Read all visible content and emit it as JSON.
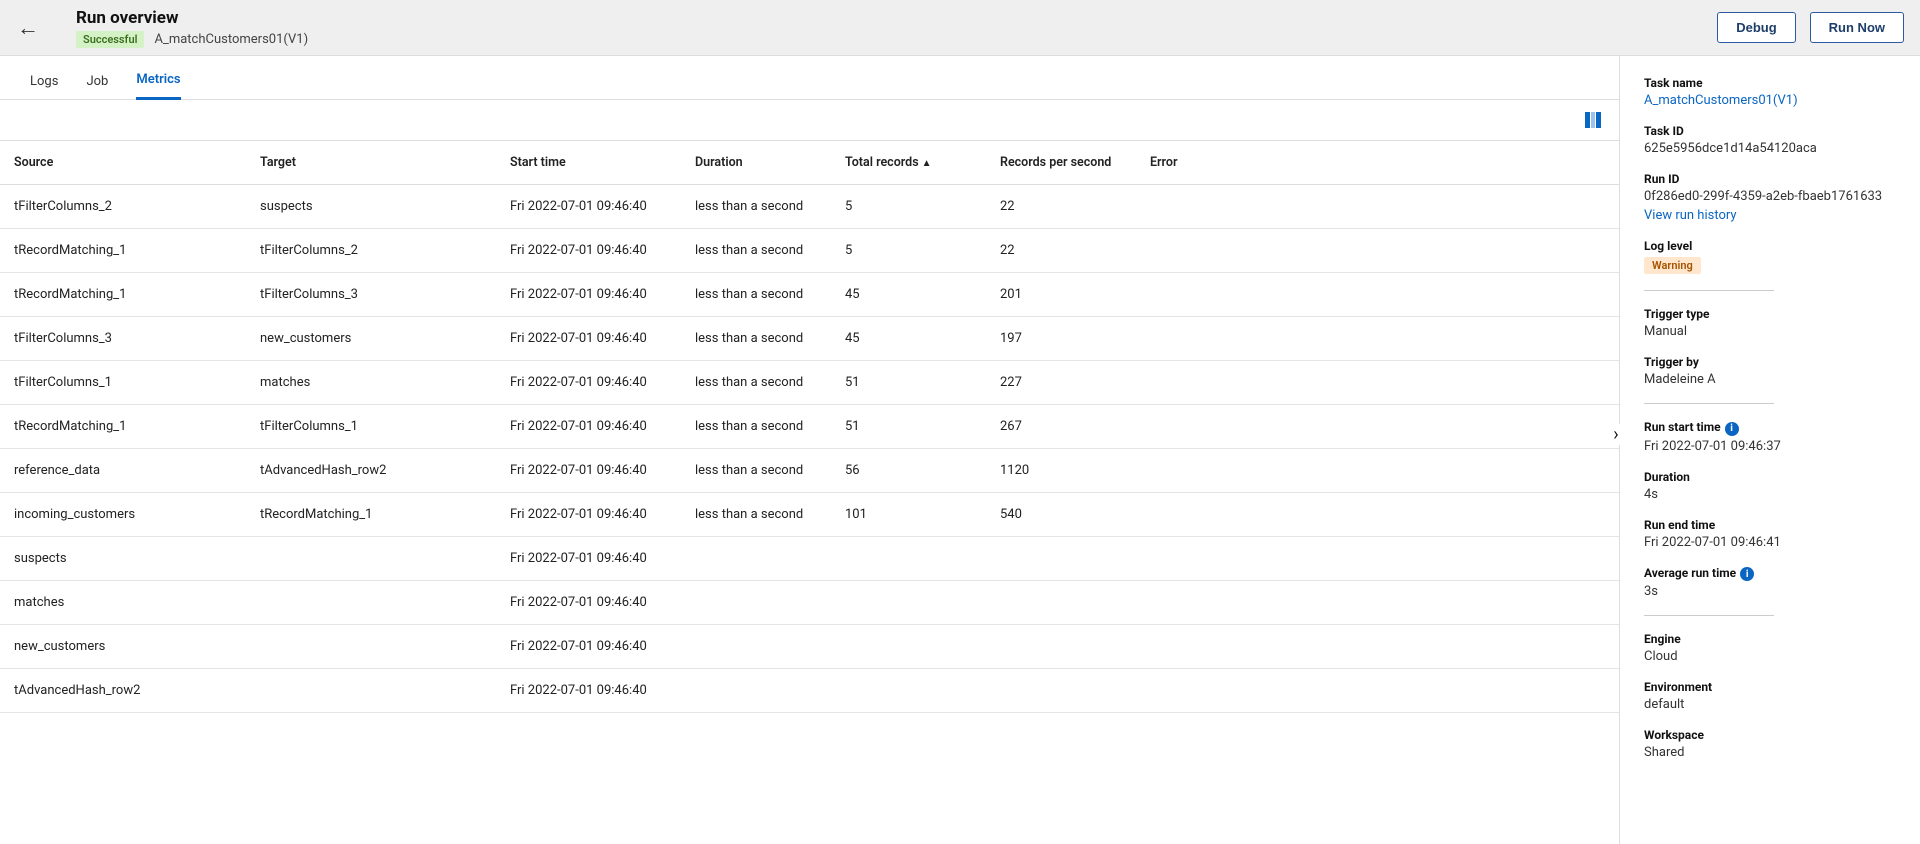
{
  "header": {
    "title": "Run overview",
    "status": "Successful",
    "task_name": "A_matchCustomers01(V1)",
    "debug_label": "Debug",
    "run_now_label": "Run Now"
  },
  "tabs": [
    {
      "label": "Logs",
      "active": false
    },
    {
      "label": "Job",
      "active": false
    },
    {
      "label": "Metrics",
      "active": true
    }
  ],
  "columns": [
    "Source",
    "Target",
    "Start time",
    "Duration",
    "Total records",
    "Records per second",
    "Error"
  ],
  "sort_column_index": 4,
  "rows": [
    {
      "source": "tFilterColumns_2",
      "target": "suspects",
      "start": "Fri 2022-07-01 09:46:40",
      "duration": "less than a second",
      "total": "5",
      "rps": "22",
      "error": ""
    },
    {
      "source": "tRecordMatching_1",
      "target": "tFilterColumns_2",
      "start": "Fri 2022-07-01 09:46:40",
      "duration": "less than a second",
      "total": "5",
      "rps": "22",
      "error": ""
    },
    {
      "source": "tRecordMatching_1",
      "target": "tFilterColumns_3",
      "start": "Fri 2022-07-01 09:46:40",
      "duration": "less than a second",
      "total": "45",
      "rps": "201",
      "error": ""
    },
    {
      "source": "tFilterColumns_3",
      "target": "new_customers",
      "start": "Fri 2022-07-01 09:46:40",
      "duration": "less than a second",
      "total": "45",
      "rps": "197",
      "error": ""
    },
    {
      "source": "tFilterColumns_1",
      "target": "matches",
      "start": "Fri 2022-07-01 09:46:40",
      "duration": "less than a second",
      "total": "51",
      "rps": "227",
      "error": ""
    },
    {
      "source": "tRecordMatching_1",
      "target": "tFilterColumns_1",
      "start": "Fri 2022-07-01 09:46:40",
      "duration": "less than a second",
      "total": "51",
      "rps": "267",
      "error": ""
    },
    {
      "source": "reference_data",
      "target": "tAdvancedHash_row2",
      "start": "Fri 2022-07-01 09:46:40",
      "duration": "less than a second",
      "total": "56",
      "rps": "1120",
      "error": ""
    },
    {
      "source": "incoming_customers",
      "target": "tRecordMatching_1",
      "start": "Fri 2022-07-01 09:46:40",
      "duration": "less than a second",
      "total": "101",
      "rps": "540",
      "error": ""
    },
    {
      "source": "suspects",
      "target": "",
      "start": "Fri 2022-07-01 09:46:40",
      "duration": "",
      "total": "",
      "rps": "",
      "error": ""
    },
    {
      "source": "matches",
      "target": "",
      "start": "Fri 2022-07-01 09:46:40",
      "duration": "",
      "total": "",
      "rps": "",
      "error": ""
    },
    {
      "source": "new_customers",
      "target": "",
      "start": "Fri 2022-07-01 09:46:40",
      "duration": "",
      "total": "",
      "rps": "",
      "error": ""
    },
    {
      "source": "tAdvancedHash_row2",
      "target": "",
      "start": "Fri 2022-07-01 09:46:40",
      "duration": "",
      "total": "",
      "rps": "",
      "error": ""
    }
  ],
  "side": {
    "task_name_label": "Task name",
    "task_name": "A_matchCustomers01(V1)",
    "task_id_label": "Task ID",
    "task_id": "625e5956dce1d14a54120aca",
    "run_id_label": "Run ID",
    "run_id": "0f286ed0-299f-4359-a2eb-fbaeb1761633",
    "view_run_history": "View run history",
    "log_level_label": "Log level",
    "log_level": "Warning",
    "trigger_type_label": "Trigger type",
    "trigger_type": "Manual",
    "trigger_by_label": "Trigger by",
    "trigger_by": "Madeleine A",
    "run_start_label": "Run start time",
    "run_start": "Fri 2022-07-01 09:46:37",
    "duration_label": "Duration",
    "duration": "4s",
    "run_end_label": "Run end time",
    "run_end": "Fri 2022-07-01 09:46:41",
    "avg_label": "Average run time",
    "avg": "3s",
    "engine_label": "Engine",
    "engine": "Cloud",
    "env_label": "Environment",
    "env": "default",
    "ws_label": "Workspace",
    "ws": "Shared"
  }
}
